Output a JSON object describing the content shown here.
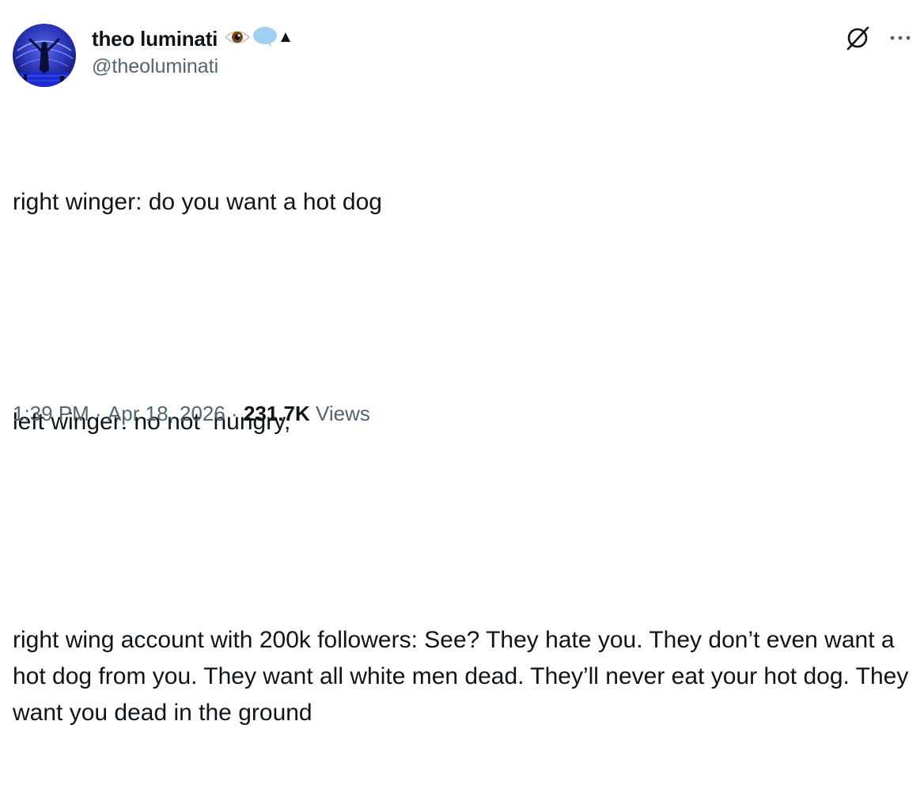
{
  "author": {
    "display_name": "theo luminati",
    "handle": "@theoluminati",
    "name_emojis": [
      "eye-emoji",
      "speech-bubble-icon",
      "triangle-icon"
    ]
  },
  "tweet": {
    "paragraphs": [
      "right winger: do you want a hot dog",
      "left winger: no not  hungry,",
      "right wing account with 200k followers: See? They hate you. They don’t even want a hot dog from you. They want all white men dead. They’ll never eat your hot dog. They want you dead in the ground"
    ]
  },
  "meta": {
    "time": "1:39 PM",
    "separator": " · ",
    "date": "Apr 18, 2026",
    "separator2": " · ",
    "views_count": "231.7K",
    "views_label": " Views"
  },
  "actions": {
    "grok_icon": "grok-icon",
    "more_icon": "more-options-icon"
  },
  "colors": {
    "text_primary": "#0f1419",
    "text_secondary": "#536471",
    "background": "#ffffff",
    "speech_bubble": "#9fd0f2"
  }
}
